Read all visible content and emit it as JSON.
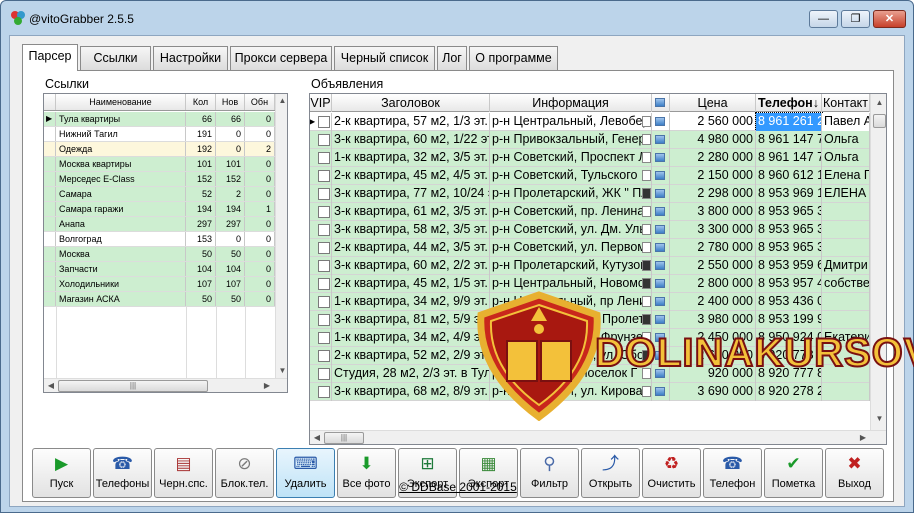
{
  "window": {
    "title": "@vitoGrabber 2.5.5",
    "min": "—",
    "max": "❐",
    "close": "✕"
  },
  "tabs": [
    "Парсер",
    "Ссылки",
    "Настройки",
    "Прокси сервера",
    "Черный список",
    "Лог",
    "О программе"
  ],
  "left": {
    "label": "Ссылки",
    "columns": [
      "Наименование",
      "Кол",
      "Нов",
      "Обн"
    ],
    "rows": [
      {
        "name": "Тула квартиры",
        "kol": "66",
        "nov": "66",
        "obn": "0",
        "color": "#cdeed0"
      },
      {
        "name": "Нижний Тагил",
        "kol": "191",
        "nov": "0",
        "obn": "0",
        "color": "#ffffff"
      },
      {
        "name": "Одежда",
        "kol": "192",
        "nov": "0",
        "obn": "2",
        "color": "#fdf7dc"
      },
      {
        "name": "Москва квартиры",
        "kol": "101",
        "nov": "101",
        "obn": "0",
        "color": "#cdeed0"
      },
      {
        "name": "Мерседес E-Class",
        "kol": "152",
        "nov": "152",
        "obn": "0",
        "color": "#cdeed0"
      },
      {
        "name": "Самара",
        "kol": "52",
        "nov": "2",
        "obn": "0",
        "color": "#cdeed0"
      },
      {
        "name": "Самара гаражи",
        "kol": "194",
        "nov": "194",
        "obn": "1",
        "color": "#cdeed0"
      },
      {
        "name": "Анапа",
        "kol": "297",
        "nov": "297",
        "obn": "0",
        "color": "#cdeed0"
      },
      {
        "name": "Волгоград",
        "kol": "153",
        "nov": "0",
        "obn": "0",
        "color": "#ffffff"
      },
      {
        "name": "Москва",
        "kol": "50",
        "nov": "50",
        "obn": "0",
        "color": "#cdeed0"
      },
      {
        "name": "Запчасти",
        "kol": "104",
        "nov": "104",
        "obn": "0",
        "color": "#cdeed0"
      },
      {
        "name": "Холодильники",
        "kol": "107",
        "nov": "107",
        "obn": "0",
        "color": "#cdeed0"
      },
      {
        "name": "Магазин АСКА",
        "kol": "50",
        "nov": "50",
        "obn": "0",
        "color": "#cdeed0"
      }
    ]
  },
  "right": {
    "label": "Объявления",
    "columns": [
      "VIP",
      "Заголовок",
      "Информация",
      "",
      "Цена",
      "Телефон↓",
      "Контакт"
    ],
    "rows": [
      {
        "title": "2-к квартира, 57 м2, 1/3 эт.",
        "info": "р-н Центральный, Левобере",
        "price": "2 560 000",
        "phone": "8 961 261 2",
        "contact": "Павел А"
      },
      {
        "title": "3-к квартира, 60 м2, 1/22 эт",
        "info": "р-н Привокзальный, Генера",
        "price": "4 980 000",
        "phone": "8 961 147 7",
        "contact": "Ольга"
      },
      {
        "title": "1-к квартира, 32 м2, 3/5 эт.",
        "info": "р-н Советский, Проспект Ле",
        "price": "2 280 000",
        "phone": "8 961 147 7",
        "contact": "Ольга"
      },
      {
        "title": "2-к квартира, 45 м2, 4/5 эт.",
        "info": "р-н Советский, Тульского Ра",
        "price": "2 150 000",
        "phone": "8 960 612 1",
        "contact": "Елена П"
      },
      {
        "title": "3-к квартира, 77 м2, 10/24 э",
        "info": "р-н Пролетарский, ЖК \" ПАР",
        "price": "2 298 000",
        "phone": "8 953 969 1",
        "contact": "ЕЛЕНА"
      },
      {
        "title": "3-к квартира, 61 м2, 3/5 эт.",
        "info": "р-н Советский, пр. Ленина",
        "price": "3 800 000",
        "phone": "8 953 965 3",
        "contact": ""
      },
      {
        "title": "3-к квартира, 58 м2, 3/5 эт.",
        "info": "р-н Советский, ул. Дм. Улья",
        "price": "3 300 000",
        "phone": "8 953 965 3",
        "contact": ""
      },
      {
        "title": "2-к квартира, 44 м2, 3/5 эт.",
        "info": "р-н Советский, ул. Первома",
        "price": "2 780 000",
        "phone": "8 953 965 3",
        "contact": ""
      },
      {
        "title": "3-к квартира, 60 м2, 2/2 эт.",
        "info": "р-н Пролетарский, Кутузова",
        "price": "2 550 000",
        "phone": "8 953 959 6",
        "contact": "Дмитри"
      },
      {
        "title": "2-к квартира, 45 м2, 1/5 эт.",
        "info": "р-н Центральный, Новомос",
        "price": "2 800 000",
        "phone": "8 953 957 4",
        "contact": "собстве"
      },
      {
        "title": "1-к квартира, 34 м2, 9/9 эт.",
        "info": "р-н Центральный, пр Ленин",
        "price": "2 400 000",
        "phone": "8 953 436 0",
        "contact": ""
      },
      {
        "title": "3-к квартира, 81 м2, 5/9 эт.",
        "info": "р-н Пролетарский, Пролета",
        "price": "3 980 000",
        "phone": "8 953 199 9",
        "contact": ""
      },
      {
        "title": "1-к квартира, 34 м2, 4/9 эт.",
        "info": "р-н Советский, ул. Фрунзе",
        "price": "2 450 000",
        "phone": "8 950 924 0",
        "contact": "Екатери"
      },
      {
        "title": "2-к квартира, 52 м2, 2/9 эт.",
        "info": "р-н Центральный, ул. Оборон",
        "price": "2 650 000",
        "phone": "8 920 778 8",
        "contact": ""
      },
      {
        "title": "Студия, 28 м2, 2/3 эт. в Тул",
        "info": "р-н Советский, поселок Г",
        "price": "920 000",
        "phone": "8 920 777 8",
        "contact": ""
      },
      {
        "title": "3-к квартира, 68 м2, 8/9 эт.",
        "info": "р-н Советский, ул. Кирова",
        "price": "3 690 000",
        "phone": "8 920 278 2",
        "contact": ""
      }
    ]
  },
  "toolbar": [
    {
      "label": "Пуск",
      "icon": "▶",
      "icon_name": "play-icon",
      "color": "#1a9a2a"
    },
    {
      "label": "Телефоны",
      "icon": "☎",
      "icon_name": "phone-icon",
      "color": "#2a5aa8"
    },
    {
      "label": "Черн.спс.",
      "icon": "▤",
      "icon_name": "blacklist-icon",
      "color": "#a83232"
    },
    {
      "label": "Блок.тел.",
      "icon": "⊘",
      "icon_name": "block-phone-icon",
      "color": "#7a7a7a"
    },
    {
      "label": "Удалить",
      "icon": "⌨",
      "icon_name": "delete-icon",
      "color": "#2a5aa8"
    },
    {
      "label": "Все фото",
      "icon": "⬇",
      "icon_name": "download-photos-icon",
      "color": "#1a9a2a"
    },
    {
      "label": "Экспорт",
      "icon": "⊞",
      "icon_name": "excel-export-icon",
      "color": "#1e7a3a"
    },
    {
      "label": "Экспорт",
      "icon": "▦",
      "icon_name": "dif-export-icon",
      "color": "#3a8a3a"
    },
    {
      "label": "Фильтр",
      "icon": "⚲",
      "icon_name": "filter-icon",
      "color": "#4a6aa8"
    },
    {
      "label": "Открыть",
      "icon": "⤴",
      "icon_name": "open-icon",
      "color": "#2a5aa8"
    },
    {
      "label": "Очистить",
      "icon": "♻",
      "icon_name": "clear-icon",
      "color": "#c02020"
    },
    {
      "label": "Телефон",
      "icon": "☎",
      "icon_name": "phone-single-icon",
      "color": "#2a5aa8"
    },
    {
      "label": "Пометка",
      "icon": "✔",
      "icon_name": "mark-icon",
      "color": "#1a9a2a"
    },
    {
      "label": "Выход",
      "icon": "✖",
      "icon_name": "exit-icon",
      "color": "#c02020"
    }
  ],
  "footer": "© DDBase 2001-2015",
  "watermark": "DOLINAKURSOV"
}
